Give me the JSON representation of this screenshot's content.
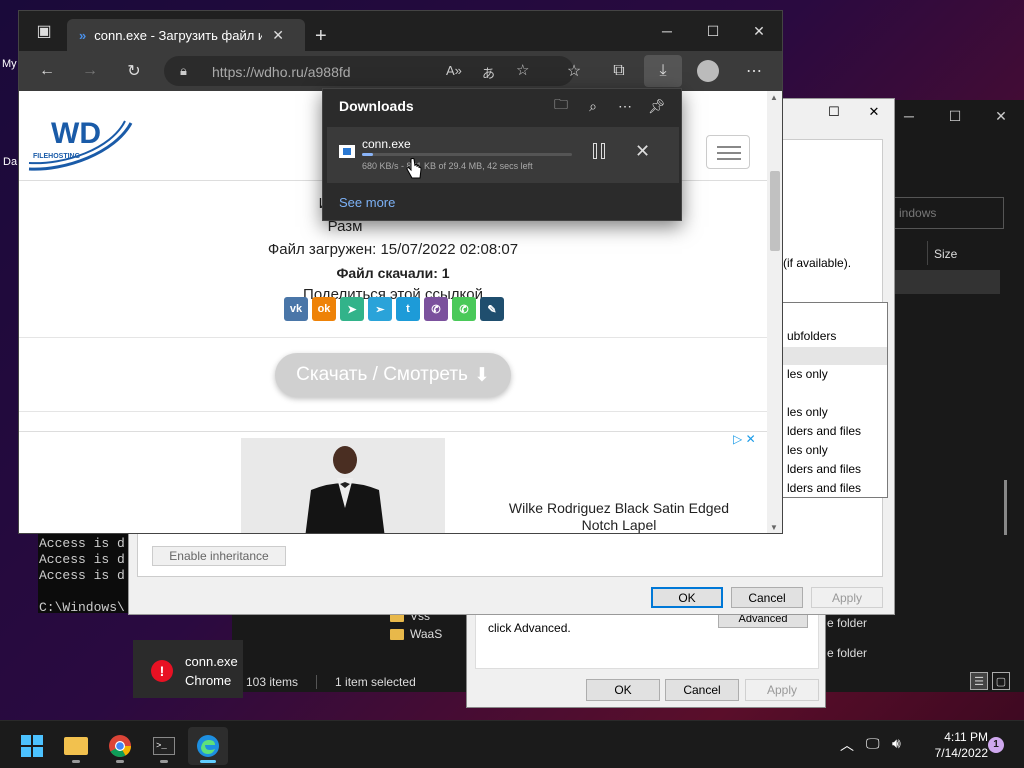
{
  "desktop": {
    "label_top": "My",
    "label_mid": "Da"
  },
  "cmd": {
    "lines": [
      "Access is d",
      "Access is d",
      "Access is d",
      "",
      "C:\\Windows\\"
    ]
  },
  "notification": {
    "line1": "conn.exe",
    "line2": "Chrome",
    "icon": "error-icon"
  },
  "explorer": {
    "search_placeholder": "indows",
    "size_header": "Size",
    "files": [
      "Vss",
      "WaaS"
    ],
    "status_items": "103 items",
    "status_selected": "1 item selected",
    "right_texts": [
      "e folder",
      "e folder"
    ]
  },
  "security_dialog": {
    "hint": "click Advanced.",
    "advanced_button": "Advanced",
    "ok": "OK",
    "cancel": "Cancel",
    "apply": "Apply"
  },
  "advanced_dialog": {
    "available_text": "(if available).",
    "enable_inheritance": "Enable inheritance",
    "list_rows": [
      "ubfolders",
      "les only",
      "les only",
      "lders and files",
      "les only",
      "lders and files",
      "lders and files"
    ],
    "ok": "OK",
    "cancel": "Cancel",
    "apply": "Apply"
  },
  "browser": {
    "tab_title": "conn.exe - Загрузить файл или с",
    "url": "https://wdho.ru/a988fd",
    "site": {
      "logo_text": "WD",
      "logo_sub": "FILEHOSTING",
      "line_name": "И",
      "line_size": "Разм",
      "uploaded": "Файл загружен: 15/07/2022 02:08:07",
      "downloads_count": "Файл скачали: 1",
      "share": "Поделиться этой ссылкой",
      "download_button": "Скачать / Смотреть",
      "ad_text": "Wilke Rodriguez Black Satin Edged Notch Lapel",
      "share_icons": [
        "vk",
        "ok",
        "msg",
        "tg",
        "tw",
        "vb",
        "wa",
        "lj"
      ]
    }
  },
  "downloads": {
    "title": "Downloads",
    "file_name": "conn.exe",
    "status": "680 KB/s - 861 KB of 29.4 MB, 42 secs left",
    "progress": 0.05,
    "see_more": "See more"
  },
  "taskbar": {
    "time": "4:11 PM",
    "date": "7/14/2022",
    "notification_count": "1"
  }
}
